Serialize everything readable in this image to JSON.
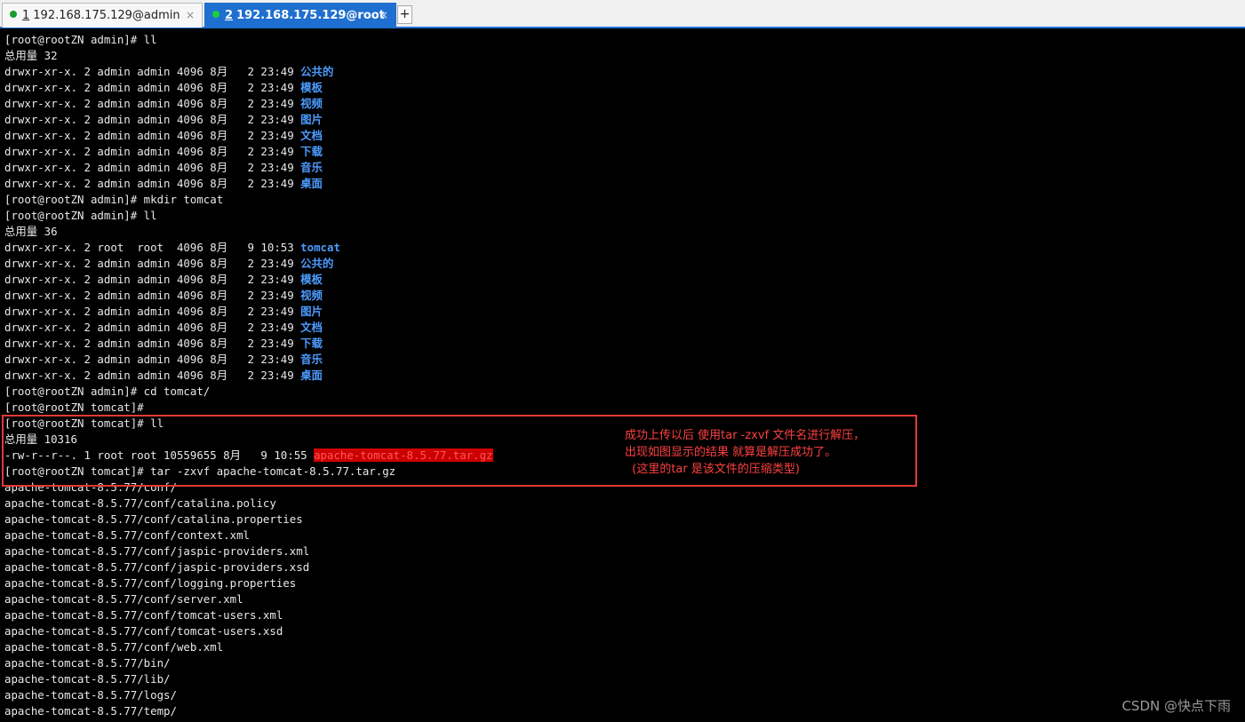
{
  "tabs": [
    {
      "number": "1",
      "label": "192.168.175.129@admin",
      "close": "×",
      "dot_color": "#1a9c2e",
      "active": false
    },
    {
      "number": "2",
      "label": "192.168.175.129@root",
      "close": "×",
      "dot_color": "#1bd13a",
      "active": true
    }
  ],
  "new_tab_label": "+",
  "terminal": {
    "lines": [
      {
        "pre": "[root@rootZN admin]# ll"
      },
      {
        "pre": "总用量 32"
      },
      {
        "pre": "drwxr-xr-x. 2 admin admin 4096 8月   2 23:49 ",
        "dir": "公共的"
      },
      {
        "pre": "drwxr-xr-x. 2 admin admin 4096 8月   2 23:49 ",
        "dir": "模板"
      },
      {
        "pre": "drwxr-xr-x. 2 admin admin 4096 8月   2 23:49 ",
        "dir": "视频"
      },
      {
        "pre": "drwxr-xr-x. 2 admin admin 4096 8月   2 23:49 ",
        "dir": "图片"
      },
      {
        "pre": "drwxr-xr-x. 2 admin admin 4096 8月   2 23:49 ",
        "dir": "文档"
      },
      {
        "pre": "drwxr-xr-x. 2 admin admin 4096 8月   2 23:49 ",
        "dir": "下载"
      },
      {
        "pre": "drwxr-xr-x. 2 admin admin 4096 8月   2 23:49 ",
        "dir": "音乐"
      },
      {
        "pre": "drwxr-xr-x. 2 admin admin 4096 8月   2 23:49 ",
        "dir": "桌面"
      },
      {
        "pre": "[root@rootZN admin]# mkdir tomcat"
      },
      {
        "pre": "[root@rootZN admin]# ll"
      },
      {
        "pre": "总用量 36"
      },
      {
        "pre": "drwxr-xr-x. 2 root  root  4096 8月   9 10:53 ",
        "dir": "tomcat"
      },
      {
        "pre": "drwxr-xr-x. 2 admin admin 4096 8月   2 23:49 ",
        "dir": "公共的"
      },
      {
        "pre": "drwxr-xr-x. 2 admin admin 4096 8月   2 23:49 ",
        "dir": "模板"
      },
      {
        "pre": "drwxr-xr-x. 2 admin admin 4096 8月   2 23:49 ",
        "dir": "视频"
      },
      {
        "pre": "drwxr-xr-x. 2 admin admin 4096 8月   2 23:49 ",
        "dir": "图片"
      },
      {
        "pre": "drwxr-xr-x. 2 admin admin 4096 8月   2 23:49 ",
        "dir": "文档"
      },
      {
        "pre": "drwxr-xr-x. 2 admin admin 4096 8月   2 23:49 ",
        "dir": "下载"
      },
      {
        "pre": "drwxr-xr-x. 2 admin admin 4096 8月   2 23:49 ",
        "dir": "音乐"
      },
      {
        "pre": "drwxr-xr-x. 2 admin admin 4096 8月   2 23:49 ",
        "dir": "桌面"
      },
      {
        "pre": "[root@rootZN admin]# cd tomcat/"
      },
      {
        "pre": "[root@rootZN tomcat]#"
      },
      {
        "pre": "[root@rootZN tomcat]# ll"
      },
      {
        "pre": "总用量 10316"
      },
      {
        "pre": "-rw-r--r--. 1 root root 10559655 8月   9 10:55 ",
        "archive": "apache-tomcat-8.5.77.tar.gz"
      },
      {
        "pre": "[root@rootZN tomcat]# tar -zxvf apache-tomcat-8.5.77.tar.gz"
      },
      {
        "pre": "apache-tomcat-8.5.77/conf/"
      },
      {
        "pre": "apache-tomcat-8.5.77/conf/catalina.policy"
      },
      {
        "pre": "apache-tomcat-8.5.77/conf/catalina.properties"
      },
      {
        "pre": "apache-tomcat-8.5.77/conf/context.xml"
      },
      {
        "pre": "apache-tomcat-8.5.77/conf/jaspic-providers.xml"
      },
      {
        "pre": "apache-tomcat-8.5.77/conf/jaspic-providers.xsd"
      },
      {
        "pre": "apache-tomcat-8.5.77/conf/logging.properties"
      },
      {
        "pre": "apache-tomcat-8.5.77/conf/server.xml"
      },
      {
        "pre": "apache-tomcat-8.5.77/conf/tomcat-users.xml"
      },
      {
        "pre": "apache-tomcat-8.5.77/conf/tomcat-users.xsd"
      },
      {
        "pre": "apache-tomcat-8.5.77/conf/web.xml"
      },
      {
        "pre": "apache-tomcat-8.5.77/bin/"
      },
      {
        "pre": "apache-tomcat-8.5.77/lib/"
      },
      {
        "pre": "apache-tomcat-8.5.77/logs/"
      },
      {
        "pre": "apache-tomcat-8.5.77/temp/"
      }
    ]
  },
  "annotation": {
    "line1": "成功上传以后 使用tar -zxvf 文件名进行解压，",
    "line2": "出现如图显示的结果 就算是解压成功了。",
    "line3": "  (这里的tar 是该文件的压缩类型)"
  },
  "watermark": "CSDN @快点下雨",
  "colors": {
    "directory": "#4b9bff",
    "archive_highlight": "#cc0000",
    "annotation": "#ff4040",
    "active_tab": "#1e6fcf"
  }
}
